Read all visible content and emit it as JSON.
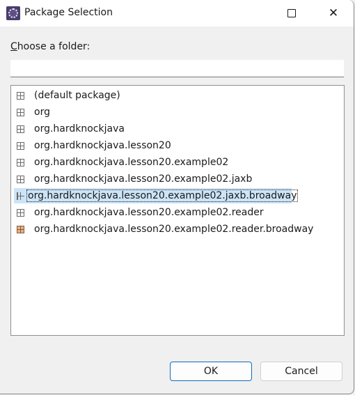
{
  "window": {
    "title": "Package Selection",
    "app_icon": "eclipse-gear-icon",
    "controls": {
      "maximize_icon": "maximize-icon",
      "close_icon": "close-icon",
      "close_glyph": "✕"
    }
  },
  "form": {
    "label_accel": "C",
    "label_rest": "hoose a folder:",
    "folder_input_value": "",
    "folder_input_placeholder": ""
  },
  "packages": {
    "selected_index": 6,
    "items": [
      {
        "label": "(default package)",
        "icon": "package-icon"
      },
      {
        "label": "org",
        "icon": "package-icon"
      },
      {
        "label": "org.hardknockjava",
        "icon": "package-icon"
      },
      {
        "label": "org.hardknockjava.lesson20",
        "icon": "package-icon"
      },
      {
        "label": "org.hardknockjava.lesson20.example02",
        "icon": "package-icon"
      },
      {
        "label": "org.hardknockjava.lesson20.example02.jaxb",
        "icon": "package-icon"
      },
      {
        "label": "org.hardknockjava.lesson20.example02.jaxb.broadway",
        "icon": "package-icon"
      },
      {
        "label": "org.hardknockjava.lesson20.example02.reader",
        "icon": "package-icon"
      },
      {
        "label": "org.hardknockjava.lesson20.example02.reader.broadway",
        "icon": "package-nonempty-icon"
      }
    ]
  },
  "buttons": {
    "ok": "OK",
    "cancel": "Cancel"
  }
}
